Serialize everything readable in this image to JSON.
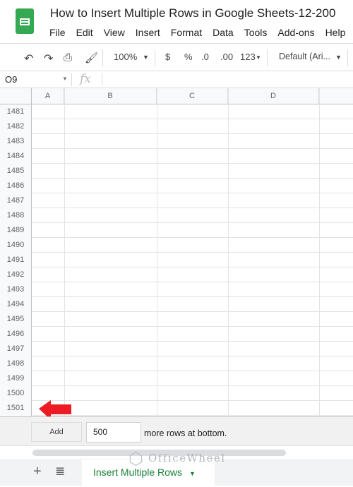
{
  "header": {
    "title": "How to Insert Multiple Rows in Google Sheets-12-200",
    "menu": [
      "File",
      "Edit",
      "View",
      "Insert",
      "Format",
      "Data",
      "Tools",
      "Add-ons",
      "Help"
    ]
  },
  "toolbar": {
    "zoom": "100%",
    "currency": "$",
    "percent": "%",
    "dec_decrease": ".0",
    "dec_increase": ".00",
    "number_format": "123",
    "font": "Default (Ari..."
  },
  "formula_bar": {
    "cell_ref": "O9",
    "fx": "fx",
    "value": ""
  },
  "columns": [
    "A",
    "B",
    "C",
    "D"
  ],
  "rows": [
    "1481",
    "1482",
    "1483",
    "1484",
    "1485",
    "1486",
    "1487",
    "1488",
    "1489",
    "1490",
    "1491",
    "1492",
    "1493",
    "1494",
    "1495",
    "1496",
    "1497",
    "1498",
    "1499",
    "1500",
    "1501"
  ],
  "add_rows": {
    "button": "Add",
    "count": "500",
    "suffix": "more rows at bottom."
  },
  "sheet_tab": {
    "label": "Insert Multiple Rows",
    "color": "#188038"
  },
  "watermark": "OfficeWheel",
  "annotation": {
    "arrow_color": "#ed1c24"
  }
}
